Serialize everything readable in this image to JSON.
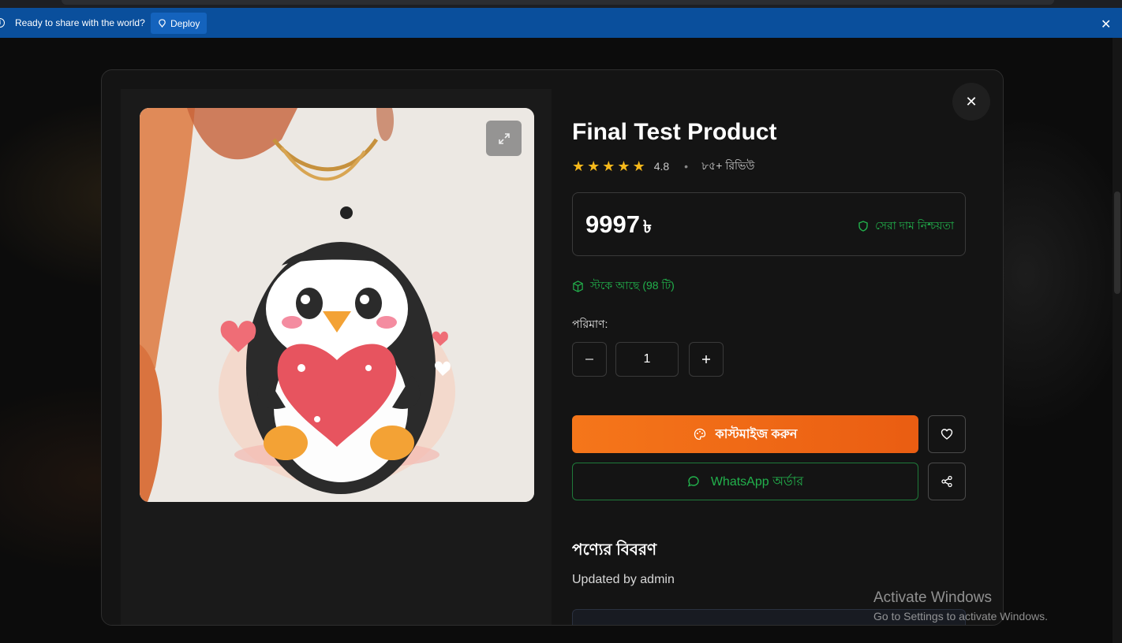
{
  "banner": {
    "message": "Ready to share with the world?",
    "deploy_label": "Deploy"
  },
  "product": {
    "title": "Final Test Product",
    "rating": "4.8",
    "review_count": "৮৫+ রিভিউ",
    "price": "9997",
    "currency": "৳",
    "guarantee": "সেরা দাম নিশ্চয়তা",
    "stock": "স্টকে আছে (98 টি)",
    "quantity_label": "পরিমাণ:",
    "quantity_value": "1",
    "customize_label": "কাস্টমাইজ করুন",
    "whatsapp_label": "WhatsApp অর্ডার",
    "description_title": "পণ্যের বিবরণ",
    "description_text": "Updated by admin"
  },
  "watermark": {
    "line1": "Activate Windows",
    "line2": "Go to Settings to activate Windows."
  },
  "colors": {
    "accent_orange": "#f5761a",
    "success_green": "#22b14c",
    "star": "#f5b81b",
    "banner_blue": "#0a4f9c"
  },
  "icons": [
    "info-icon",
    "deploy-icon",
    "close-icon",
    "expand-icon",
    "star-icon",
    "shield-icon",
    "package-icon",
    "minus-icon",
    "plus-icon",
    "palette-icon",
    "heart-icon",
    "chat-icon",
    "share-icon"
  ]
}
